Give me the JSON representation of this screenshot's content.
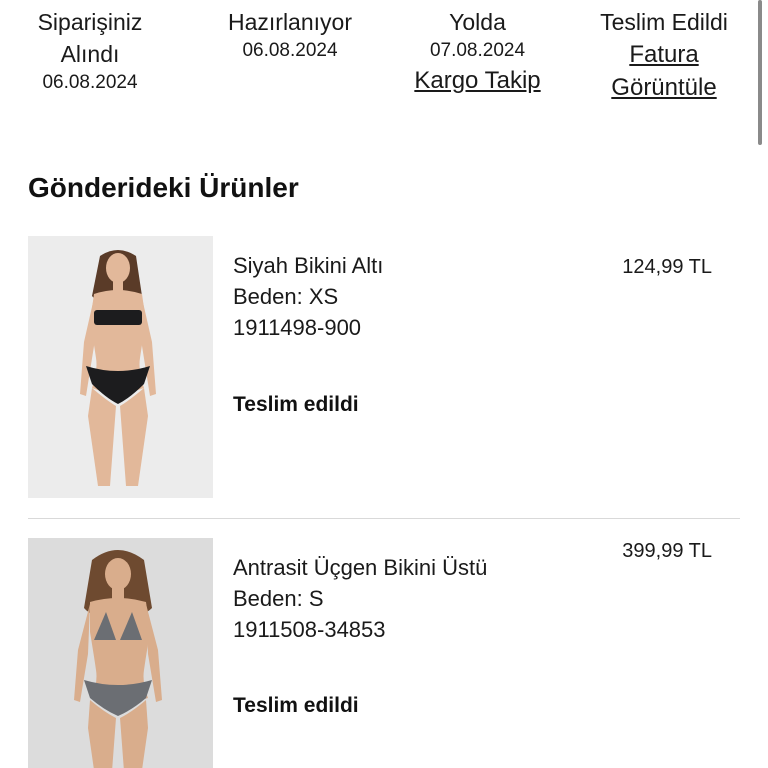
{
  "status_steps": [
    {
      "title_line1": "Siparişiniz",
      "title_line2": "Alındı",
      "date": "06.08.2024"
    },
    {
      "title": "Hazırlanıyor",
      "date": "06.08.2024"
    },
    {
      "title": "Yolda",
      "date": "07.08.2024",
      "link": "Kargo Takip"
    },
    {
      "title": "Teslim Edildi",
      "link_line1": "Fatura",
      "link_line2": "Görüntüle"
    }
  ],
  "section_title": "Gönderideki Ürünler",
  "items": [
    {
      "name": "Siyah Bikini Altı",
      "size": "Beden: XS",
      "sku": "1911498-900",
      "price": "124,99 TL",
      "status": "Teslim edildi",
      "swimsuit_color": "#1c1c1e"
    },
    {
      "name": "Antrasit Üçgen Bikini Üstü",
      "size": "Beden: S",
      "sku": "1911508-34853",
      "price": "399,99 TL",
      "status": "Teslim edildi",
      "swimsuit_color": "#6b6e73"
    }
  ],
  "colors": {
    "text": "#111111",
    "divider": "#d9d9d9",
    "photo_bg": "#e9e9e9"
  }
}
